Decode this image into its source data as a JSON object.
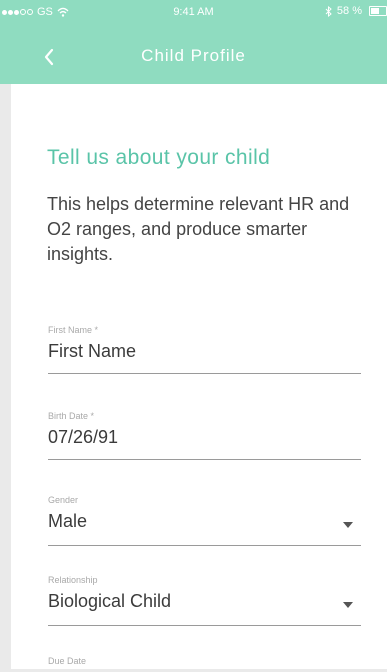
{
  "status": {
    "carrier": "GS",
    "time": "9:41 AM",
    "battery": "58 %",
    "battery_level": 0.58
  },
  "nav": {
    "title": "Child Profile",
    "back_icon": "chevron-left-icon"
  },
  "content": {
    "title": "Tell us about your child",
    "subtitle": "This helps determine relevant HR and O2 ranges, and produce smarter insights."
  },
  "fields": [
    {
      "label": "First Name *",
      "value": "First Name",
      "type": "text"
    },
    {
      "label": "Birth Date *",
      "value": "07/26/91",
      "type": "date"
    },
    {
      "label": "Gender",
      "value": "Male",
      "type": "select"
    },
    {
      "label": "Relationship",
      "value": "Biological Child",
      "type": "select"
    },
    {
      "label": "Due Date",
      "value": "",
      "type": "date"
    }
  ],
  "colors": {
    "header": "#8fdcc0",
    "accent": "#5ac4a8"
  }
}
